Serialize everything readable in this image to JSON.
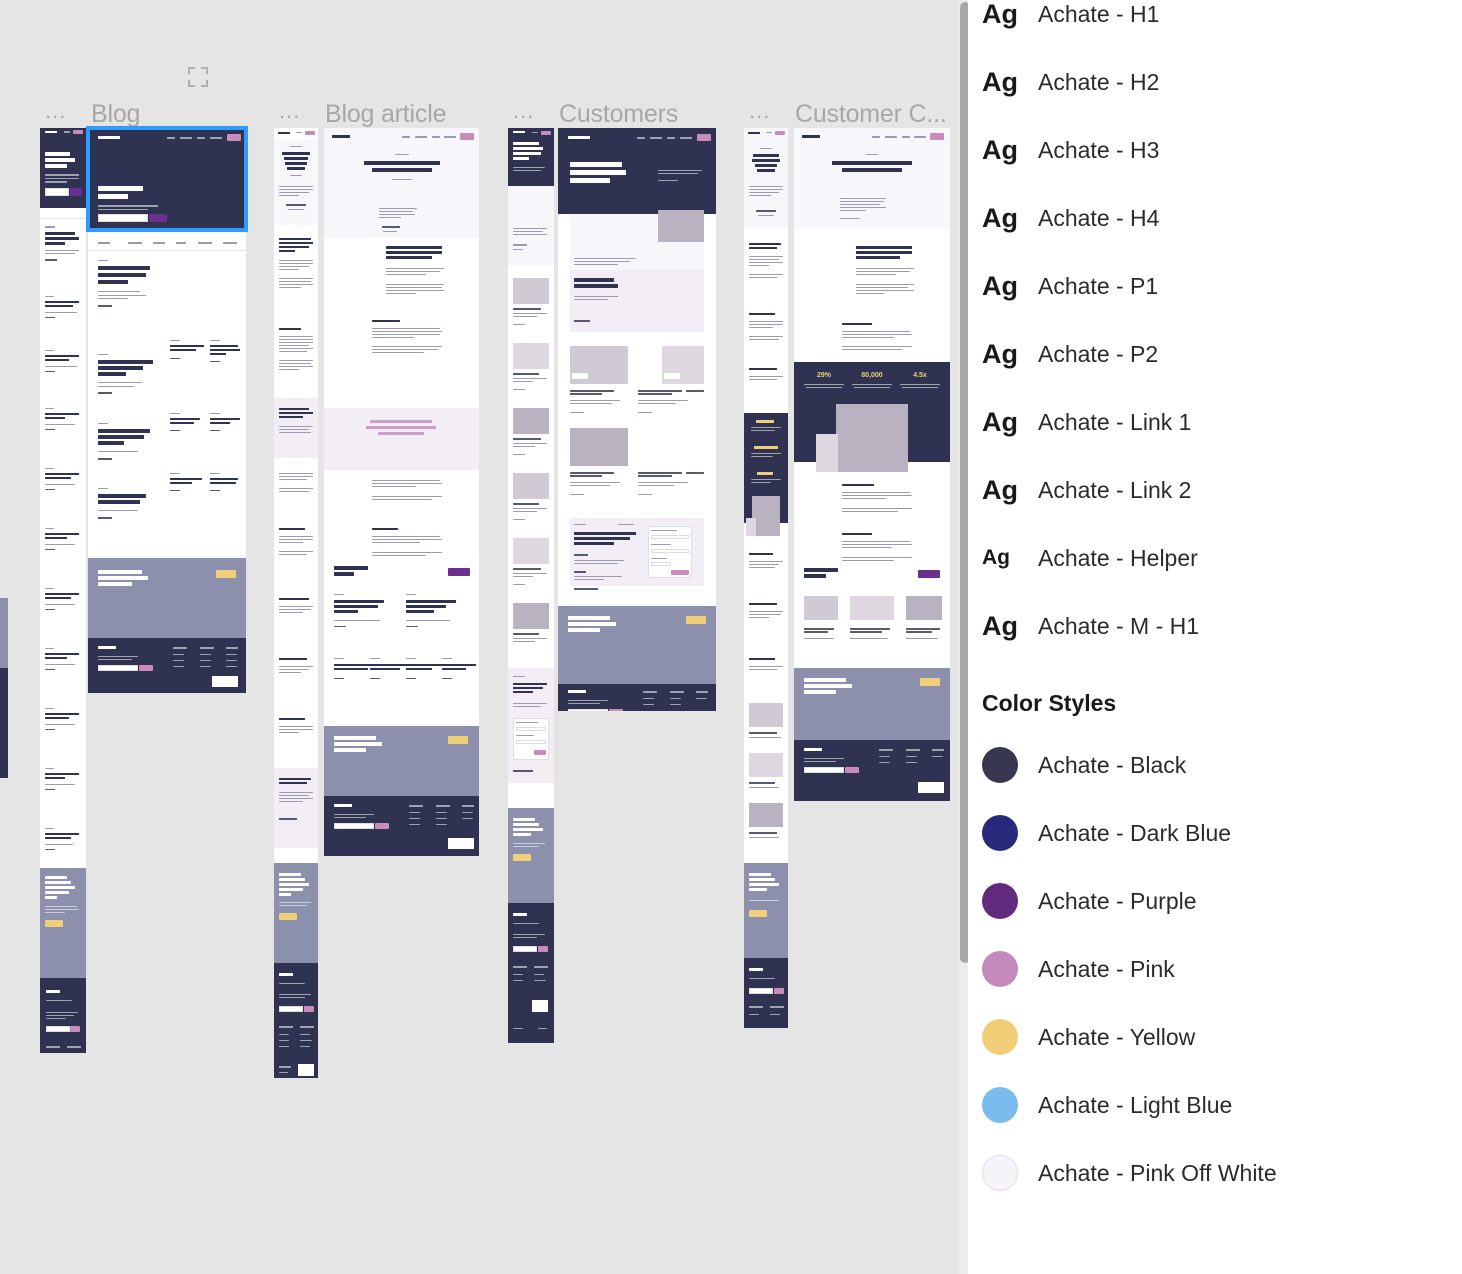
{
  "canvas": {
    "background_color": "#e5e5e5",
    "expand_icon": "expand-icon",
    "frames": [
      {
        "dots": "...",
        "title": "Blog",
        "selected": true
      },
      {
        "dots": "...",
        "title": "Blog article",
        "selected": false
      },
      {
        "dots": "...",
        "title": "Customers",
        "selected": false
      },
      {
        "dots": "...",
        "title": "Customer C...",
        "selected": false
      }
    ],
    "selection_color": "#2e9bff",
    "mockup_text": {
      "blog_hero_heading": "Start learning with us today.",
      "blog_heading_2": "What two years in the industry have taught us.",
      "blog_heading_3": "We have collaborated with Two Park to promote their autumn collection",
      "blog_heading_4": "Explore our new offices in Downtown Chicago",
      "blog_heading_5": "12 apps for finding creators to collaborate with",
      "blog_cta": "Perfect for business owners looking to ship things fast.",
      "article_heading": "Explore our new offices in Downtown Chicago",
      "article_lead": "At the end of 2018, we decided that our next move should be an office in Chicago.",
      "article_more": "Read more articles like this.",
      "article_cta_heading": "We have collaborated with Two Park to promote their autumn collection",
      "article_cta_heading_2": "Explore our new offices in Downtown Chicago",
      "customers_heading": "We asked our dear customers what they think about us.",
      "customers_quote": "Trust me when I say Achate is amazing.",
      "customers_cta": "Perfect for business owners looking to ship things fast.",
      "case_heading": "Impression increased their engagement with Achate",
      "case_lead": "At the end of 2018, we decided that our next move should be an office in Chicago.",
      "case_stats": [
        "29%",
        "80,000",
        "4.5x"
      ],
      "case_more": "Read more case studies like this.",
      "case_cta": "Perfect for business owners looking to ship things fast."
    }
  },
  "panel": {
    "text_styles": [
      {
        "label": "Achate - H1",
        "ag": "Ag",
        "size": "lg"
      },
      {
        "label": "Achate - H2",
        "ag": "Ag",
        "size": "lg"
      },
      {
        "label": "Achate - H3",
        "ag": "Ag",
        "size": "lg"
      },
      {
        "label": "Achate - H4",
        "ag": "Ag",
        "size": "lg"
      },
      {
        "label": "Achate - P1",
        "ag": "Ag",
        "size": "lg"
      },
      {
        "label": "Achate - P2",
        "ag": "Ag",
        "size": "lg"
      },
      {
        "label": "Achate - Link 1",
        "ag": "Ag",
        "size": "lg"
      },
      {
        "label": "Achate - Link 2",
        "ag": "Ag",
        "size": "lg"
      },
      {
        "label": "Achate - Helper",
        "ag": "Ag",
        "size": "sm"
      },
      {
        "label": "Achate - M - H1",
        "ag": "Ag",
        "size": "lg"
      }
    ],
    "color_section_title": "Color Styles",
    "color_styles": [
      {
        "label": "Achate - Black",
        "hex": "#373751"
      },
      {
        "label": "Achate - Dark Blue",
        "hex": "#27297a"
      },
      {
        "label": "Achate - Purple",
        "hex": "#602b7e"
      },
      {
        "label": "Achate - Pink",
        "hex": "#c489bb"
      },
      {
        "label": "Achate - Yellow",
        "hex": "#f2cd78"
      },
      {
        "label": "Achate - Light Blue",
        "hex": "#78bdee"
      },
      {
        "label": "Achate - Pink Off White",
        "hex": "#f6f3fb",
        "ring": true
      }
    ]
  },
  "scrollbar": {
    "name": "vertical-scrollbar"
  }
}
